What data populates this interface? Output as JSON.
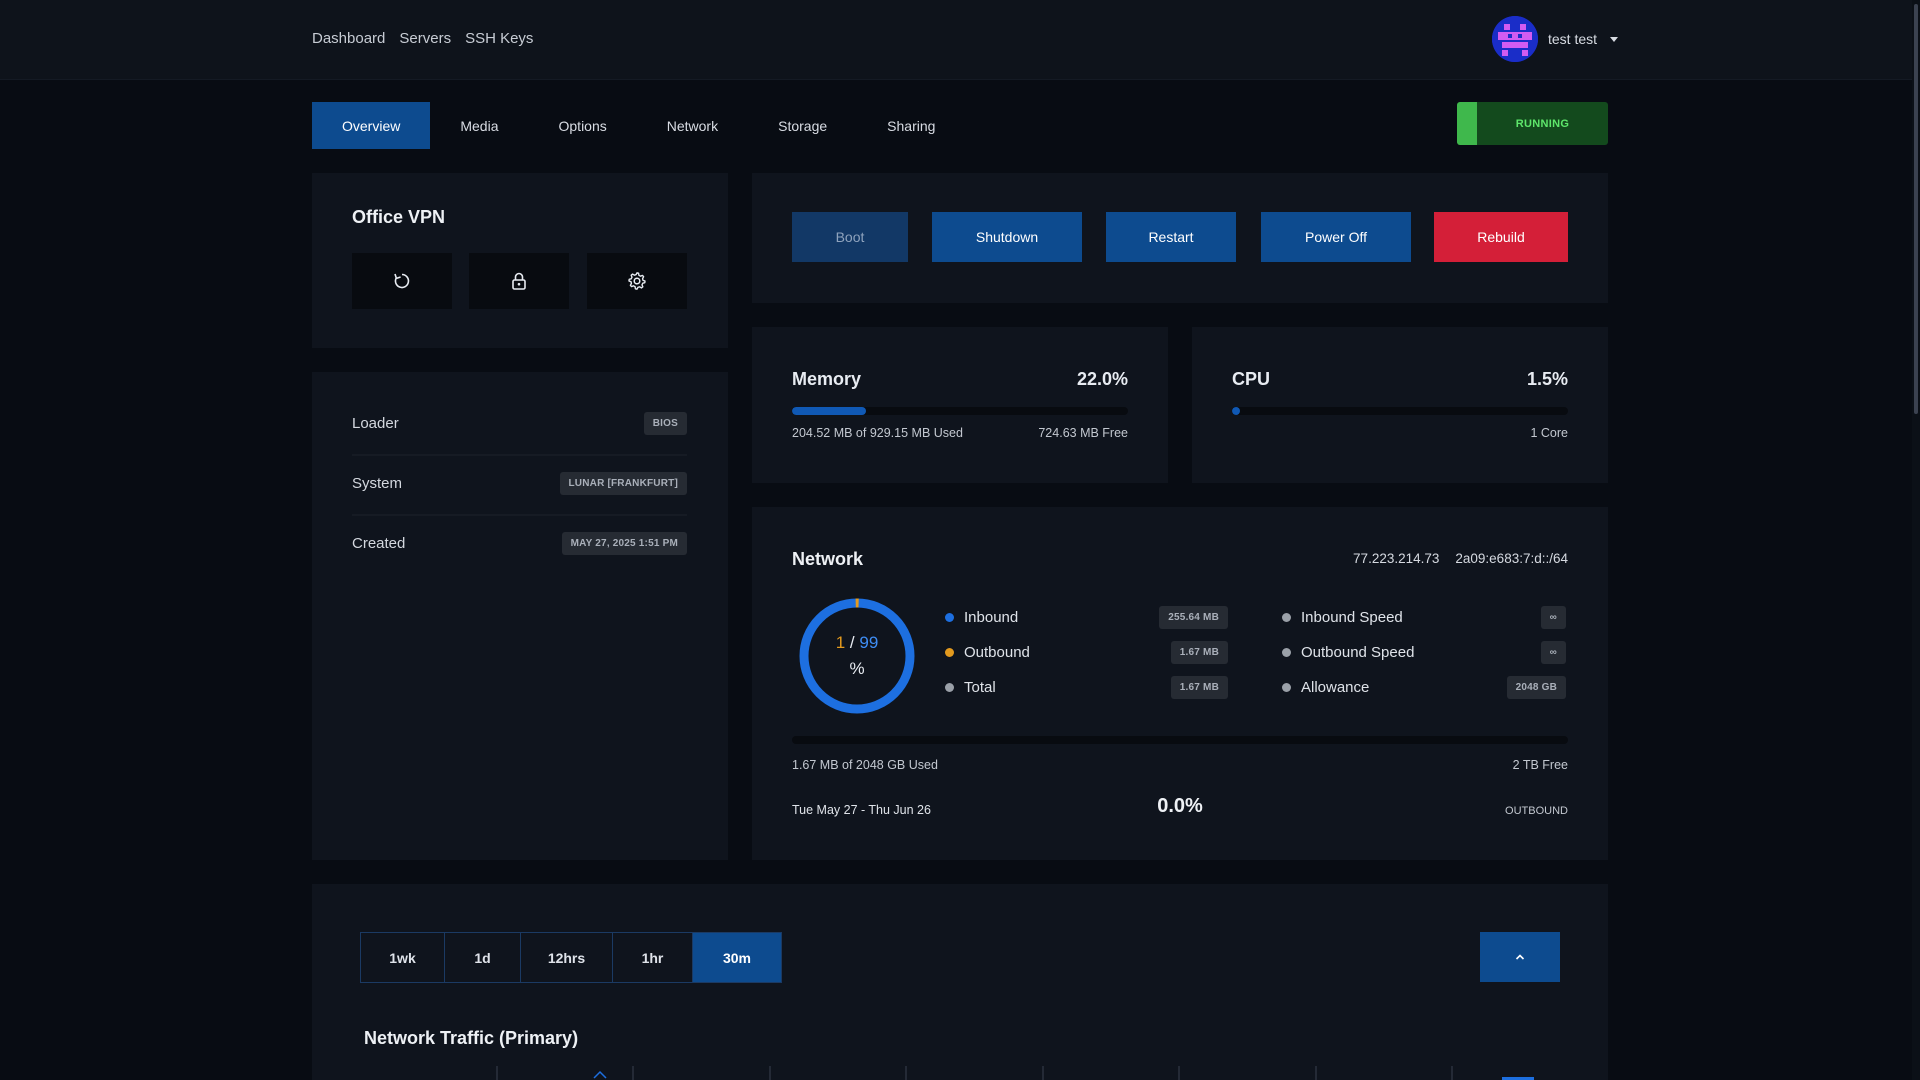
{
  "nav": {
    "links": [
      "Dashboard",
      "Servers",
      "SSH Keys"
    ],
    "user_name": "test test"
  },
  "tabs": [
    "Overview",
    "Media",
    "Options",
    "Network",
    "Storage",
    "Sharing"
  ],
  "status": "RUNNING",
  "server": {
    "name": "Office VPN",
    "icons": [
      "refresh-icon",
      "lock-icon",
      "gear-icon"
    ]
  },
  "details": [
    {
      "label": "Loader",
      "value": "BIOS"
    },
    {
      "label": "System",
      "value": "LUNAR [FRANKFURT]"
    },
    {
      "label": "Created",
      "value": "MAY 27, 2025 1:51 PM"
    }
  ],
  "actions": {
    "boot": "Boot",
    "shutdown": "Shutdown",
    "restart": "Restart",
    "power_off": "Power Off",
    "rebuild": "Rebuild"
  },
  "memory": {
    "title": "Memory",
    "percent": "22.0%",
    "fill_fraction": 0.22,
    "used": "204.52 MB of 929.15 MB Used",
    "free": "724.63 MB Free"
  },
  "cpu": {
    "title": "CPU",
    "percent": "1.5%",
    "fill_fraction": 0.015,
    "cores": "1 Core"
  },
  "network": {
    "title": "Network",
    "ipv4": "77.223.214.73",
    "ipv6": "2a09:e683:7:d::/64",
    "donut": {
      "outbound": "1",
      "sep": "/",
      "inbound": "99",
      "unit": "%",
      "outbound_fraction": 0.01
    },
    "legend_left": [
      {
        "label": "Inbound",
        "value": "255.64 MB",
        "color": "#1d6fe0"
      },
      {
        "label": "Outbound",
        "value": "1.67 MB",
        "color": "#e39a1e"
      },
      {
        "label": "Total",
        "value": "1.67 MB",
        "color": "#9aa0a8"
      }
    ],
    "legend_right": [
      {
        "label": "Inbound Speed",
        "value": "∞",
        "color": "#9aa0a8"
      },
      {
        "label": "Outbound Speed",
        "value": "∞",
        "color": "#9aa0a8"
      },
      {
        "label": "Allowance",
        "value": "2048 GB",
        "color": "#9aa0a8"
      }
    ],
    "usage_fraction": 0.0,
    "used": "1.67 MB of 2048 GB Used",
    "free": "2 TB Free",
    "period": "Tue May 27 - Thu Jun 26",
    "period_percent": "0.0%",
    "direction": "OUTBOUND"
  },
  "graph": {
    "ranges": [
      "1wk",
      "1d",
      "12hrs",
      "1hr",
      "30m"
    ],
    "active_range": "30m",
    "title": "Network Traffic (Primary)"
  },
  "colors": {
    "accent": "#0d4b8f",
    "danger": "#d41f38",
    "success": "#3fb84c",
    "inbound": "#1d6fe0",
    "outbound": "#e39a1e"
  }
}
